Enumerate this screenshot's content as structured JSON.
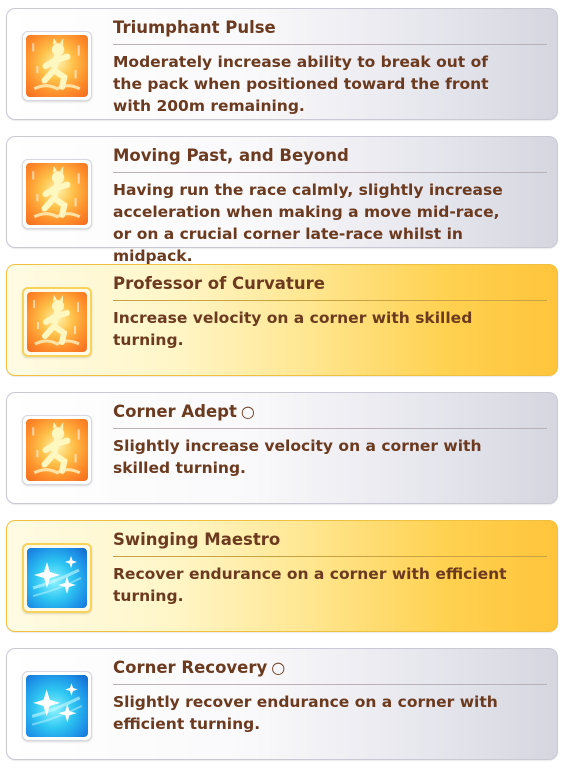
{
  "skills": [
    {
      "title": "Triumphant Pulse",
      "mark": "",
      "description": "Moderately increase ability to break out of the pack when positioned toward the front with 200m remaining.",
      "highlighted": false,
      "icon": "running-figure-icon",
      "icon_color": "orange"
    },
    {
      "title": "Moving Past, and Beyond",
      "mark": "",
      "description": "Having run the race calmly, slightly increase acceleration when making a move mid-race, or on a crucial corner late-race whilst in midpack.",
      "highlighted": false,
      "icon": "running-figure-icon",
      "icon_color": "orange"
    },
    {
      "title": "Professor of Curvature",
      "mark": "",
      "description": "Increase velocity on a corner with skilled turning.",
      "highlighted": true,
      "icon": "running-figure-icon",
      "icon_color": "orange"
    },
    {
      "title": "Corner Adept",
      "mark": "○",
      "description": "Slightly increase velocity on a corner with skilled turning.",
      "highlighted": false,
      "icon": "running-figure-icon",
      "icon_color": "orange"
    },
    {
      "title": "Swinging Maestro",
      "mark": "",
      "description": "Recover endurance on a corner with efficient turning.",
      "highlighted": true,
      "icon": "sparkle-icon",
      "icon_color": "blue"
    },
    {
      "title": "Corner Recovery",
      "mark": "○",
      "description": "Slightly recover endurance on a corner with efficient turning.",
      "highlighted": false,
      "icon": "sparkle-icon",
      "icon_color": "blue"
    }
  ],
  "colors": {
    "text": "#6b3a1f",
    "highlight_start": "#fffbe4",
    "highlight_end": "#ffc43c",
    "card_end": "#d6d6e0"
  }
}
